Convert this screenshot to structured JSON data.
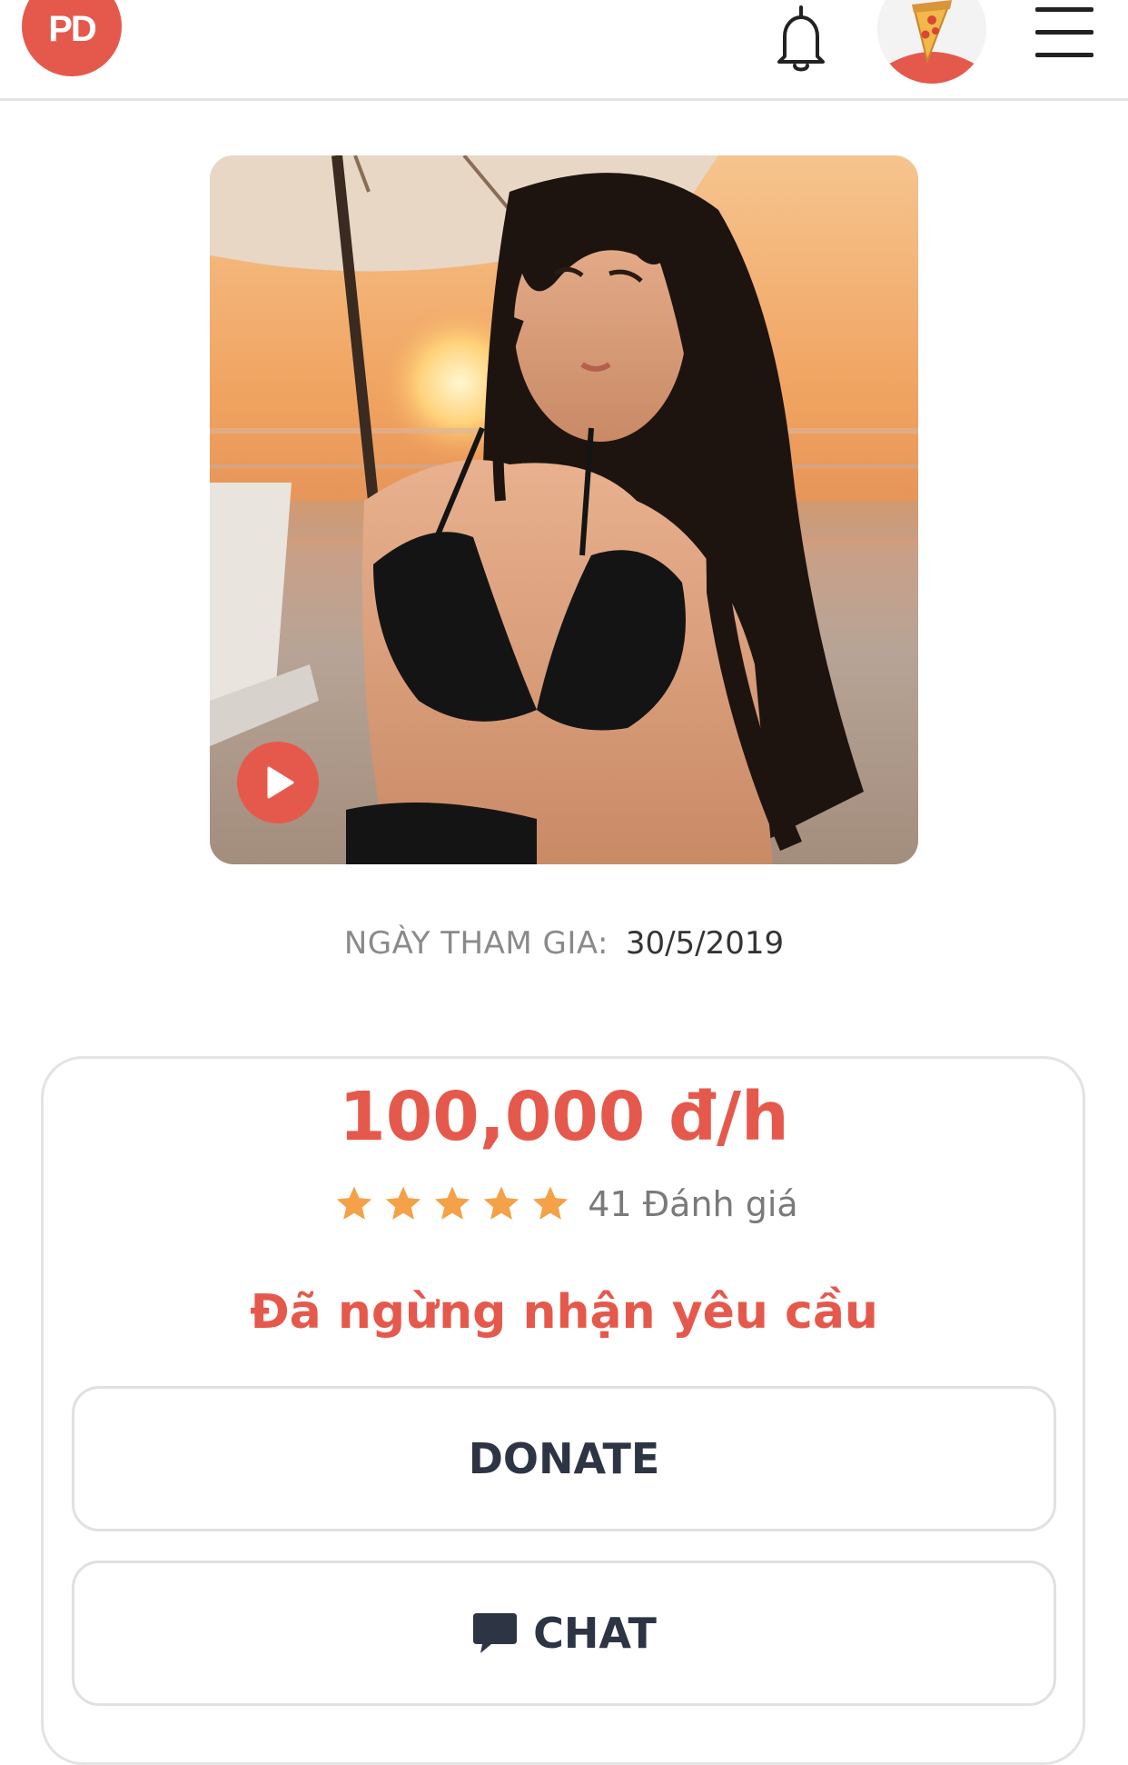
{
  "header": {
    "logo_text": "PD",
    "icons": [
      "bell-icon",
      "pizza-avatar",
      "hamburger-menu-icon"
    ]
  },
  "profile": {
    "join_label": "NGÀY THAM GIA:",
    "join_date": "30/5/2019"
  },
  "card": {
    "price": "100,000 đ/h",
    "stars": 5,
    "rating_text": "41 Đánh giá",
    "status": "Đã ngừng nhận yêu cầu",
    "donate_label": "DONATE",
    "chat_label": "CHAT"
  },
  "colors": {
    "accent": "#e5594c",
    "star": "#f4a147",
    "button_text": "#2d3444",
    "muted": "#8a8a8a"
  }
}
